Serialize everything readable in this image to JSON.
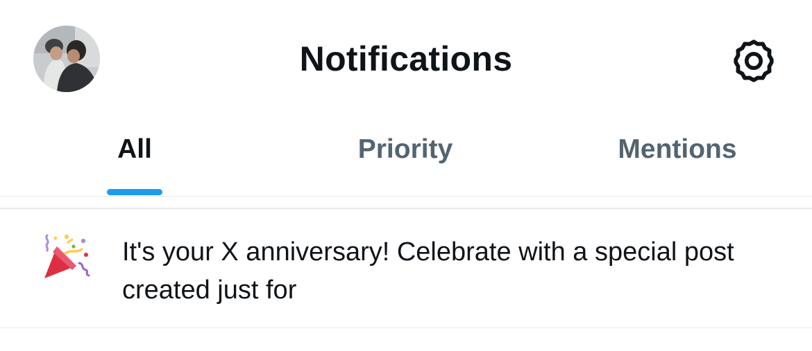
{
  "header": {
    "title": "Notifications",
    "avatar_icon": "profile-avatar",
    "settings_icon": "gear-icon"
  },
  "tabs": [
    {
      "label": "All",
      "active": true
    },
    {
      "label": "Priority",
      "active": false
    },
    {
      "label": "Mentions",
      "active": false
    }
  ],
  "notifications": [
    {
      "icon": "party-popper-icon",
      "text": "It's your X anniversary! Celebrate with a special post created just for"
    }
  ],
  "colors": {
    "accent": "#1d9bf0",
    "text_primary": "#0f1419",
    "text_secondary": "#536471",
    "divider": "#e6e9eb"
  }
}
